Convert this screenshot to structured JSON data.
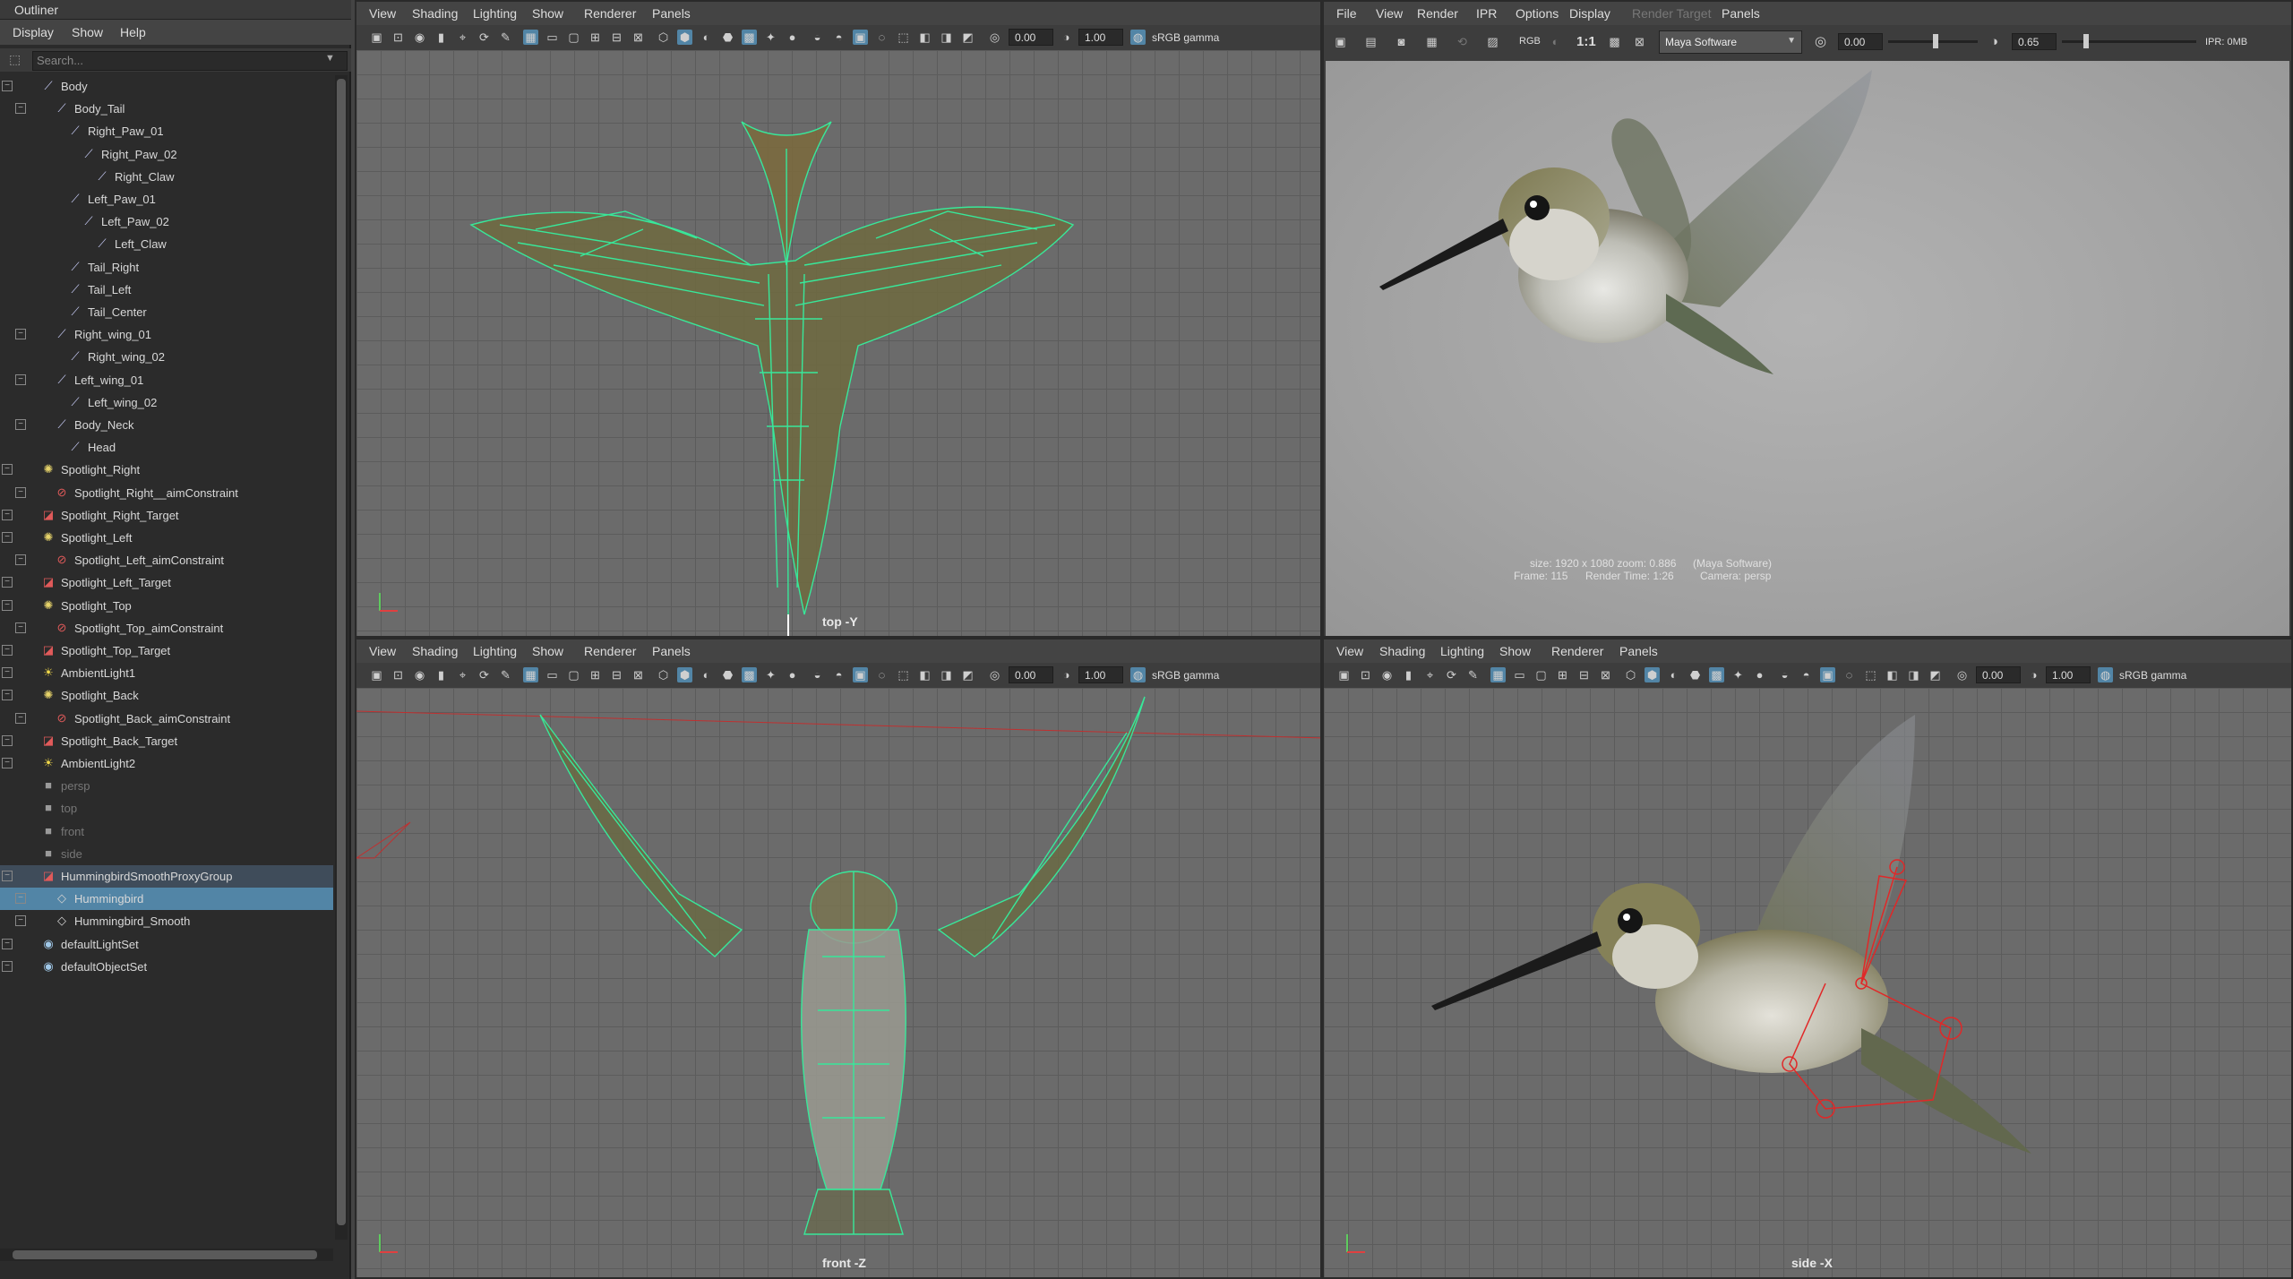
{
  "outliner": {
    "title": "Outliner",
    "menu": [
      "Display",
      "Show",
      "Help"
    ],
    "search_placeholder": "Search...",
    "items": [
      {
        "label": "Body",
        "depth": 1,
        "icon": "joint-icon"
      },
      {
        "label": "Body_Tail",
        "depth": 2,
        "icon": "joint-icon"
      },
      {
        "label": "Right_Paw_01",
        "depth": 3,
        "icon": "joint-icon"
      },
      {
        "label": "Right_Paw_02",
        "depth": 4,
        "icon": "joint-icon"
      },
      {
        "label": "Right_Claw",
        "depth": 5,
        "icon": "joint-icon"
      },
      {
        "label": "Left_Paw_01",
        "depth": 3,
        "icon": "joint-icon"
      },
      {
        "label": "Left_Paw_02",
        "depth": 4,
        "icon": "joint-icon"
      },
      {
        "label": "Left_Claw",
        "depth": 5,
        "icon": "joint-icon"
      },
      {
        "label": "Tail_Right",
        "depth": 3,
        "icon": "joint-icon"
      },
      {
        "label": "Tail_Left",
        "depth": 3,
        "icon": "joint-icon"
      },
      {
        "label": "Tail_Center",
        "depth": 3,
        "icon": "joint-icon"
      },
      {
        "label": "Right_wing_01",
        "depth": 2,
        "icon": "joint-icon"
      },
      {
        "label": "Right_wing_02",
        "depth": 3,
        "icon": "joint-icon"
      },
      {
        "label": "Left_wing_01",
        "depth": 2,
        "icon": "joint-icon"
      },
      {
        "label": "Left_wing_02",
        "depth": 3,
        "icon": "joint-icon"
      },
      {
        "label": "Body_Neck",
        "depth": 2,
        "icon": "joint-icon"
      },
      {
        "label": "Head",
        "depth": 3,
        "icon": "joint-icon"
      },
      {
        "label": "Spotlight_Right",
        "depth": 1,
        "icon": "spotlight-icon"
      },
      {
        "label": "Spotlight_Right__aimConstraint",
        "depth": 2,
        "icon": "constraint-icon"
      },
      {
        "label": "Spotlight_Right_Target",
        "depth": 1,
        "icon": "target-icon"
      },
      {
        "label": "Spotlight_Left",
        "depth": 1,
        "icon": "spotlight-icon"
      },
      {
        "label": "Spotlight_Left_aimConstraint",
        "depth": 2,
        "icon": "constraint-icon"
      },
      {
        "label": "Spotlight_Left_Target",
        "depth": 1,
        "icon": "target-icon"
      },
      {
        "label": "Spotlight_Top",
        "depth": 1,
        "icon": "spotlight-icon"
      },
      {
        "label": "Spotlight_Top_aimConstraint",
        "depth": 2,
        "icon": "constraint-icon"
      },
      {
        "label": "Spotlight_Top_Target",
        "depth": 1,
        "icon": "target-icon"
      },
      {
        "label": "AmbientLight1",
        "depth": 1,
        "icon": "ambient-light-icon"
      },
      {
        "label": "Spotlight_Back",
        "depth": 1,
        "icon": "spotlight-icon"
      },
      {
        "label": "Spotlight_Back_aimConstraint",
        "depth": 2,
        "icon": "constraint-icon"
      },
      {
        "label": "Spotlight_Back_Target",
        "depth": 1,
        "icon": "target-icon"
      },
      {
        "label": "AmbientLight2",
        "depth": 1,
        "icon": "ambient-light-icon"
      },
      {
        "label": "persp",
        "depth": 1,
        "icon": "camera-icon",
        "dim": true
      },
      {
        "label": "top",
        "depth": 1,
        "icon": "camera-icon",
        "dim": true
      },
      {
        "label": "front",
        "depth": 1,
        "icon": "camera-icon",
        "dim": true
      },
      {
        "label": "side",
        "depth": 1,
        "icon": "camera-icon",
        "dim": true
      },
      {
        "label": "HummingbirdSmoothProxyGroup",
        "depth": 1,
        "icon": "group-icon",
        "highlight": true
      },
      {
        "label": "Hummingbird",
        "depth": 2,
        "icon": "mesh-icon",
        "selected": true
      },
      {
        "label": "Hummingbird_Smooth",
        "depth": 2,
        "icon": "mesh-icon"
      },
      {
        "label": "defaultLightSet",
        "depth": 1,
        "icon": "set-icon"
      },
      {
        "label": "defaultObjectSet",
        "depth": 1,
        "icon": "set-icon"
      }
    ]
  },
  "viewports": {
    "menu": [
      "View",
      "Shading",
      "Lighting",
      "Show",
      "Renderer",
      "Panels"
    ],
    "exposure": "0.00",
    "gamma": "1.00",
    "color_space": "sRGB gamma",
    "top": {
      "camera": "top -Y"
    },
    "front": {
      "camera": "front -Z"
    },
    "side": {
      "camera": "side -X"
    }
  },
  "render_view": {
    "menu": [
      "File",
      "View",
      "Render",
      "IPR",
      "Options",
      "Display",
      "Render Target",
      "Panels"
    ],
    "renderer": "Maya Software",
    "ratio": "1:1",
    "exposure": "0.00",
    "gamma": "0.65",
    "ipr_mem": "IPR: 0MB",
    "info_size": "size: 1920 x 1080 zoom: 0.886",
    "info_renderer": "(Maya Software)",
    "info_frame": "Frame: 115",
    "info_time": "Render Time: 1:26",
    "info_camera": "Camera: persp"
  },
  "colors": {
    "selection": "#5285a6",
    "wireframe": "#38e89a",
    "grid": "#6b6b6b"
  }
}
